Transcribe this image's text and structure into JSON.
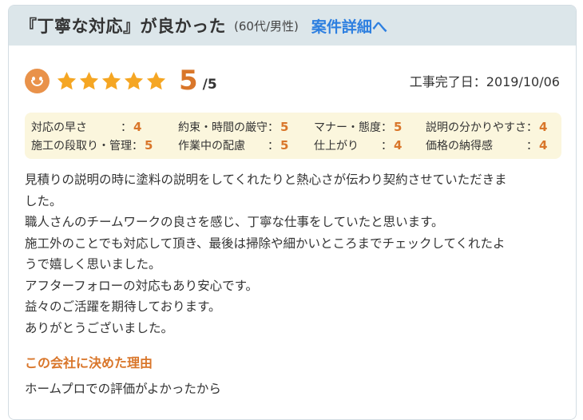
{
  "header": {
    "title": "『丁寧な対応』が良かった",
    "author": "(60代/男性)",
    "detail_link": "案件詳細へ"
  },
  "rating": {
    "stars": 5,
    "score": "5",
    "max": "/5",
    "completion": "工事完了日：2019/10/06"
  },
  "scores": [
    [
      {
        "label": "対応の早さ　　　：",
        "value": "4"
      },
      {
        "label": "約束・時間の厳守：",
        "value": "5"
      },
      {
        "label": "マナー・態度：",
        "value": "5"
      },
      {
        "label": "説明の分かりやすさ：",
        "value": "4"
      }
    ],
    [
      {
        "label": "施工の段取り・管理：",
        "value": "5"
      },
      {
        "label": "作業中の配慮　　：",
        "value": "5"
      },
      {
        "label": "仕上がり　　：",
        "value": "4"
      },
      {
        "label": "価格の納得感　　　：",
        "value": "4"
      }
    ]
  ],
  "review": {
    "lines": [
      "見積りの説明の時に塗料の説明をしてくれたりと熱心さが伝わり契約させていただきま",
      "した。",
      "職人さんのチームワークの良さを感じ、丁寧な仕事をしていたと思います。",
      "施工外のことでも対応して頂き、最後は掃除や細かいところまでチェックしてくれたよ",
      "うで嬉しく思いました。",
      "アフターフォローの対応もあり安心です。",
      "益々のご活躍を期待しております。",
      "ありがとうございました。"
    ]
  },
  "reason": {
    "title": "この会社に決めた理由",
    "text": "ホームプロでの評価がよかったから"
  },
  "colors": {
    "accent": "#d9762a",
    "star": "#f5a623",
    "link": "#2d7fe0",
    "header_bg": "#dce6ea",
    "scores_bg": "#fbf6dd"
  },
  "icons": {
    "smiley": "smiley-face-icon",
    "star": "star-icon"
  }
}
